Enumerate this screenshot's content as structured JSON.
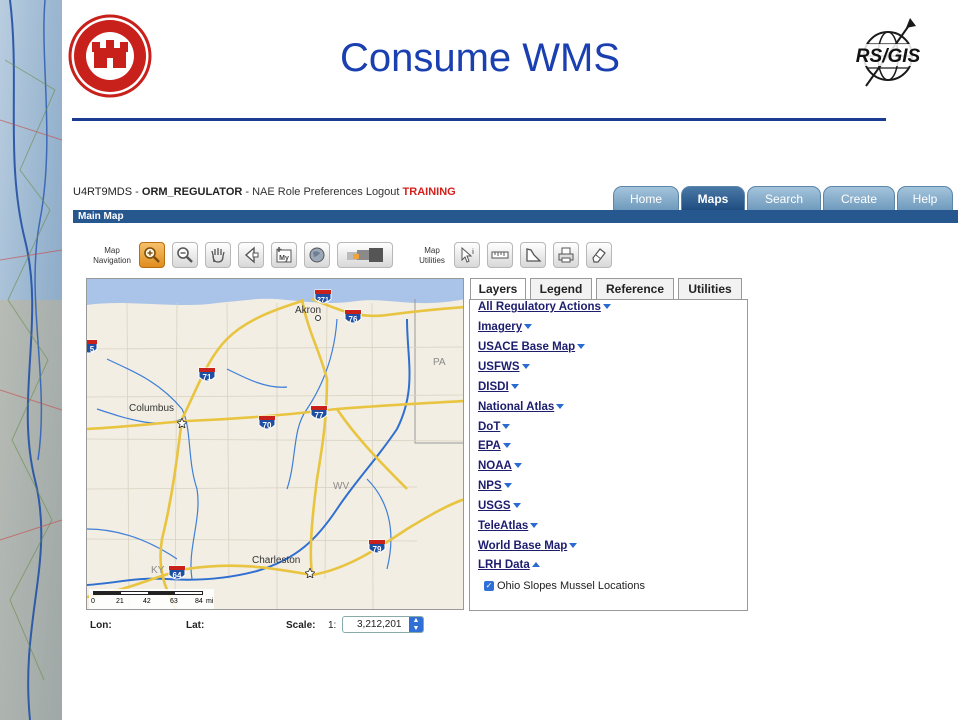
{
  "slide": {
    "title": "Consume WMS"
  },
  "logos": {
    "cerl": {
      "top_text": "U.S. ARMY",
      "center_text": "CERL",
      "ring_text": "RESEARCH AND DEVELOPMENT"
    },
    "rsgis": {
      "text": "RS/GIS"
    }
  },
  "app": {
    "header": {
      "user_id": "U4RT9MDS",
      "separator": "-",
      "role": "ORM_REGULATOR",
      "links": "- NAE Role Preferences Logout",
      "mode": "TRAINING"
    },
    "nav_tabs": [
      "Home",
      "Maps",
      "Search",
      "Create",
      "Help"
    ],
    "active_nav_tab": "Maps",
    "section_title": "Main Map",
    "toolbar": {
      "map_navigation_label": "Map\nNavigation",
      "map_utilities_label": "Map\nUtilities",
      "navigation_tools": [
        "zoom-in-icon",
        "zoom-out-icon",
        "pan-hand-icon",
        "previous-extent-icon",
        "my-extent-icon",
        "full-extent-globe-icon",
        "layers-stack-icon"
      ],
      "utility_tools": [
        "identify-icon",
        "measure-ruler-icon",
        "area-measure-icon",
        "print-icon",
        "clear-eraser-icon"
      ]
    },
    "map": {
      "places": [
        "Columbus",
        "Akron",
        "Charleston"
      ],
      "states": [
        "PA",
        "WV",
        "KY"
      ],
      "interstate_shields": [
        "271",
        "76",
        "71",
        "70",
        "77",
        "79",
        "64",
        "5"
      ],
      "scale_bar": {
        "ticks": [
          "0",
          "21",
          "42",
          "63",
          "84"
        ],
        "unit": "mi"
      }
    },
    "coord_bar": {
      "lon_label": "Lon:",
      "lat_label": "Lat:",
      "scale_label": "Scale:",
      "scale_prefix": "1:",
      "scale_value": "3,212,201"
    },
    "panel_tabs": [
      "Layers",
      "Legend",
      "Reference",
      "Utilities"
    ],
    "active_panel_tab": "Layers",
    "layers": [
      "All Regulatory Actions",
      "Imagery",
      "USACE Base Map",
      "USFWS",
      "DISDI",
      "National Atlas",
      "DoT",
      "EPA",
      "NOAA",
      "NPS",
      "USGS",
      "TeleAtlas",
      "World Base Map",
      "LRH Data"
    ],
    "expanded_layer": "LRH Data",
    "sublayer": {
      "label": "Ohio Slopes Mussel Locations",
      "checked": true
    }
  }
}
